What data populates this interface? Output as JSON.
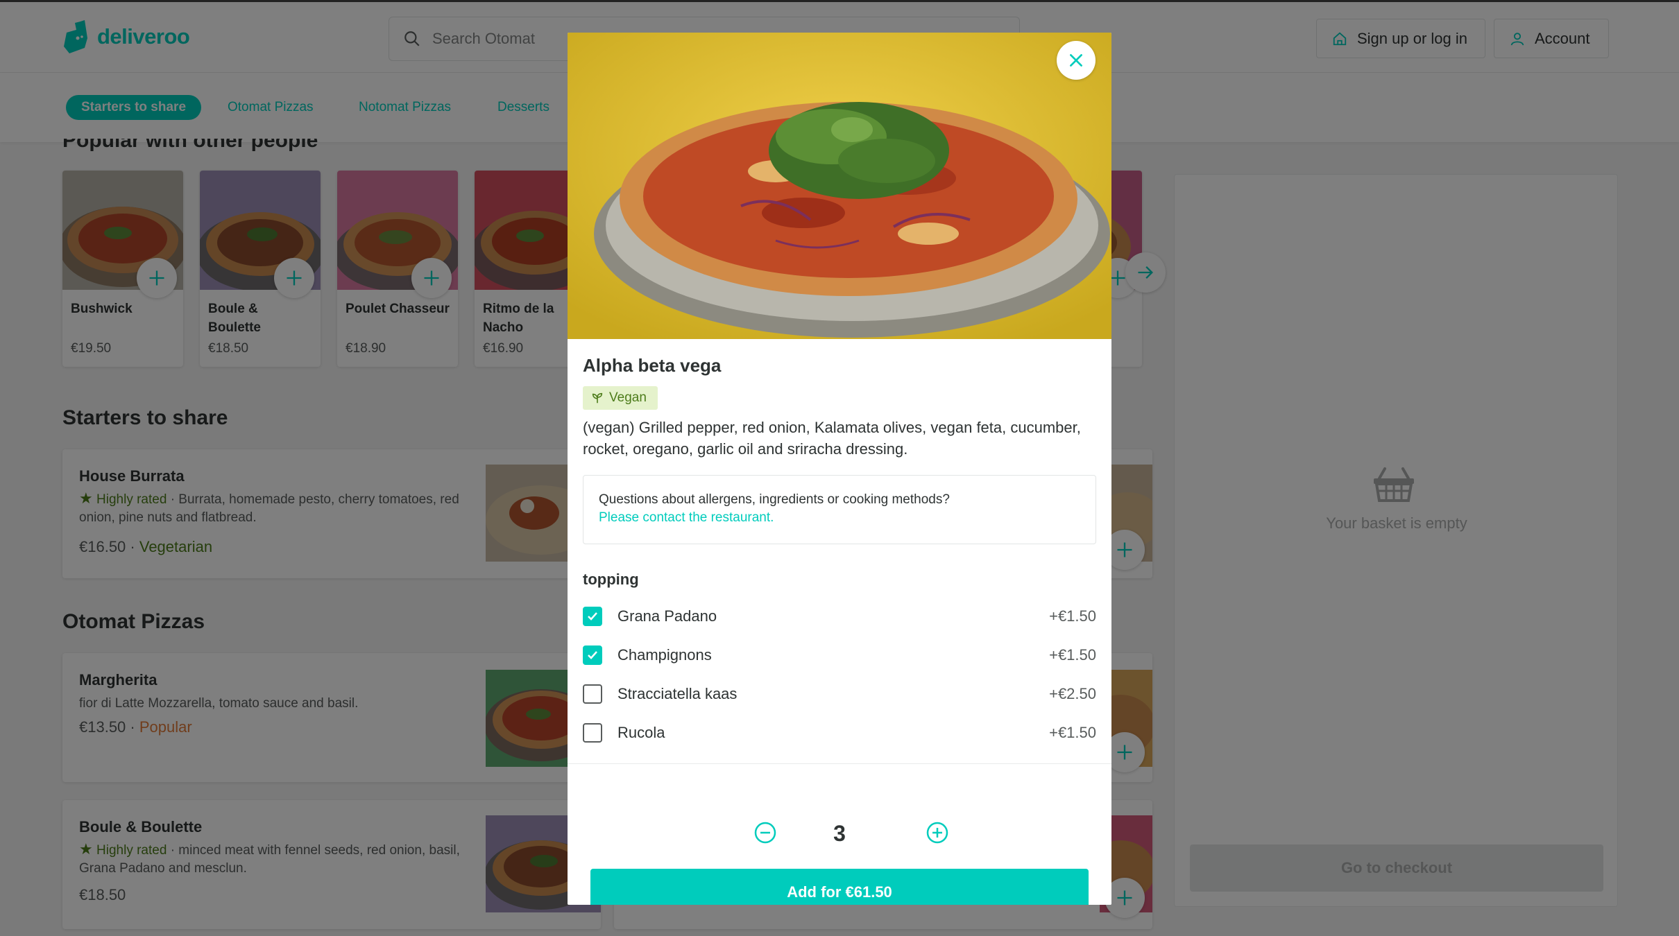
{
  "header": {
    "logo_text": "deliveroo",
    "search_placeholder": "Search Otomat",
    "signup_label": "Sign up or log in",
    "account_label": "Account"
  },
  "categories": [
    "Starters to share",
    "Otomat Pizzas",
    "Notomat Pizzas",
    "Desserts"
  ],
  "popular": {
    "title": "Popular with other people",
    "items": [
      {
        "name": "Bushwick",
        "price": "€19.50"
      },
      {
        "name": "Boule & Boulette",
        "price": "€18.50"
      },
      {
        "name": "Poulet Chasseur",
        "price": "€18.90"
      },
      {
        "name": "Ritmo de la Nacho",
        "price": "€16.90"
      }
    ]
  },
  "starters": {
    "title": "Starters to share",
    "items": [
      {
        "name": "House Burrata",
        "rating": "Highly rated",
        "desc": "Burrata, homemade pesto, cherry tomatoes, red onion, pine nuts and flatbread.",
        "price": "€16.50",
        "tag": "Vegetarian"
      }
    ]
  },
  "pizzas": {
    "title": "Otomat Pizzas",
    "items": [
      {
        "name": "Margherita",
        "desc": "fior di Latte Mozzarella, tomato sauce and basil.",
        "price": "€13.50",
        "tag": "Popular"
      },
      {
        "name": "Boule & Boulette",
        "rating": "Highly rated",
        "desc": "minced meat with fennel seeds, red onion, basil, Grana Padano and mesclun.",
        "price": "€18.50"
      }
    ]
  },
  "basket": {
    "empty_text": "Your basket is empty",
    "checkout_label": "Go to checkout"
  },
  "modal": {
    "title": "Alpha beta vega",
    "badge": "Vegan",
    "description": "(vegan) Grilled pepper, red onion, Kalamata olives, vegan feta, cucumber, rocket, oregano, garlic oil and sriracha dressing.",
    "allergen_question": "Questions about allergens, ingredients or cooking methods?",
    "allergen_link": "Please contact the restaurant.",
    "group_title": "topping",
    "options": [
      {
        "label": "Grana Padano",
        "price": "+€1.50",
        "checked": true
      },
      {
        "label": "Champignons",
        "price": "+€1.50",
        "checked": true
      },
      {
        "label": "Stracciatella kaas",
        "price": "+€2.50",
        "checked": false
      },
      {
        "label": "Rucola",
        "price": "+€1.50",
        "checked": false
      }
    ],
    "quantity": "3",
    "add_label": "Add for €61.50"
  },
  "colors": {
    "brand": "#00ccbc",
    "vegan_bg": "#e5f2cc",
    "vegan_text": "#4d7c1b",
    "popular": "#e07b39"
  },
  "icons": {
    "logo": "kangaroo-logo-icon",
    "search": "search-icon",
    "home": "home-icon",
    "user": "user-icon",
    "plus": "plus-icon",
    "arrow": "arrow-right-icon",
    "star": "star-icon",
    "basket": "basket-icon",
    "close": "close-icon",
    "leaf": "leaf-icon",
    "check": "check-icon",
    "minus_circle": "minus-circle-icon",
    "plus_circle": "plus-circle-icon"
  }
}
